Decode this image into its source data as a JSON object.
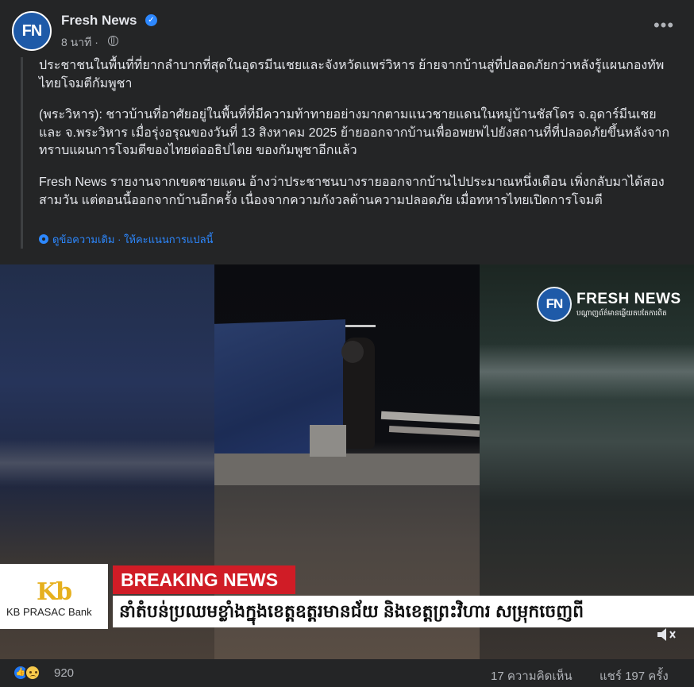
{
  "header": {
    "avatar_text": "FN",
    "page_name": "Fresh News",
    "verified_mark": "✓",
    "time_ago": "8 นาที ·",
    "more_label": "•••"
  },
  "post": {
    "paragraph_1": "ประชาชนในพื้นที่ที่ยากลำบากที่สุดในอุดรมีนเชยและจังหวัดแพร่วิหาร ย้ายจากบ้านสู่ที่ปลอดภัยกว่าหลังรู้แผนกองทัพไทยโจมตีกัมพูชา",
    "paragraph_2": "(พระวิหาร): ชาวบ้านที่อาศัยอยู่ในพื้นที่ที่มีความท้าทายอย่างมากตามแนวชายแดนในหมู่บ้านชัสโดร จ.อุดาร์มีนเชย และ จ.พระวิหาร เมื่อรุ่งอรุณของวันที่ 13 สิงหาคม 2025 ย้ายออกจากบ้านเพื่ออพยพไปยังสถานที่ที่ปลอดภัยขึ้นหลังจากทราบแผนการโจมตีของไทยต่ออธิปไตย ของกัมพูชาอีกแล้ว",
    "paragraph_3": "Fresh News รายงานจากเขตชายแดน อ้างว่าประชาชนบางรายออกจากบ้านไปประมาณหนึ่งเดือน เพิ่งกลับมาได้สองสามวัน แต่ตอนนี้ออกจากบ้านอีกครั้ง เนื่องจากความกังวลด้านความปลอดภัย เมื่อทหารไทยเปิดการโจมตี",
    "see_original": "ดูข้อความเดิม",
    "separator": " · ",
    "rate_translation": "ให้คะแนนการแปลนี้"
  },
  "media": {
    "watermark_logo": "FN",
    "watermark_name": "FRESH NEWS",
    "watermark_sub": "បណ្តាញព័ត៌មានឆ្លើយតបតែការពិត",
    "bank_logo": "Kb",
    "bank_name": "KB PRASAC Bank",
    "breaking_label": "BREAKING NEWS",
    "ticker_text": "នាំតំបន់ប្រឈមខ្លាំងក្នុងខេត្តឧត្តរមានជ័យ និងខេត្តព្រះវិហារ សម្រុកចេញពី"
  },
  "footer": {
    "reaction_count": "920",
    "comments": "17 ความคิดเห็น",
    "shares": "แชร์ 197 ครั้ง"
  },
  "colors": {
    "background": "#242526",
    "link": "#2d88ff",
    "breaking_red": "#d01c26",
    "like_blue": "#2078f4"
  },
  "icons": [
    "globe-icon",
    "more-icon",
    "gear-icon",
    "like-icon",
    "sad-icon",
    "mute-icon",
    "verified-icon"
  ]
}
